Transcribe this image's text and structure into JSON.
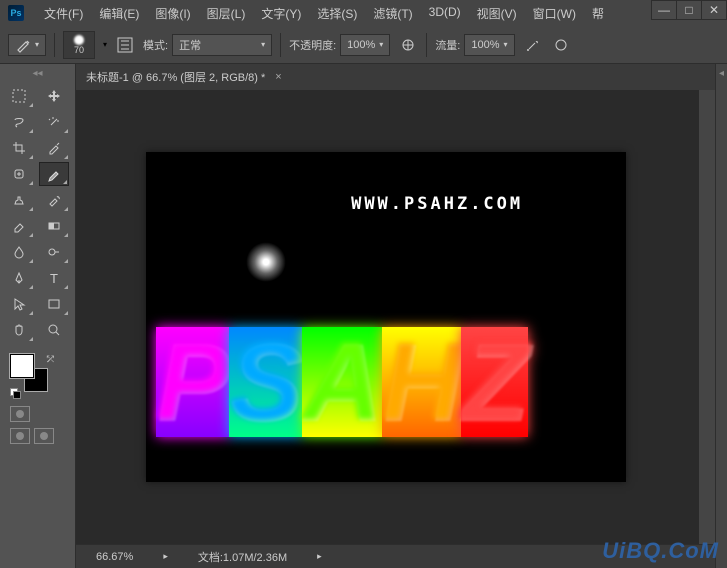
{
  "app": {
    "logo_text": "Ps"
  },
  "menu": {
    "file": "文件(F)",
    "edit": "编辑(E)",
    "image": "图像(I)",
    "layer": "图层(L)",
    "type": "文字(Y)",
    "select": "选择(S)",
    "filter": "滤镜(T)",
    "3d": "3D(D)",
    "view": "视图(V)",
    "window": "窗口(W)",
    "help": "帮"
  },
  "window_controls": {
    "minimize": "—",
    "maximize": "□",
    "close": "✕"
  },
  "options": {
    "brush_size": "70",
    "mode_label": "模式:",
    "mode_value": "正常",
    "opacity_label": "不透明度:",
    "opacity_value": "100%",
    "flow_label": "流量:",
    "flow_value": "100%"
  },
  "document": {
    "tab_title": "未标题-1 @ 66.7% (图层 2, RGB/8) *",
    "tab_close": "×"
  },
  "canvas": {
    "url_text": "WWW.PSAHZ.COM",
    "letters": [
      "P",
      "S",
      "A",
      "H",
      "Z"
    ]
  },
  "status": {
    "zoom": "66.67%",
    "doc_label": "文档:",
    "doc_size": "1.07M/2.36M"
  },
  "swatch": {
    "fg": "#ffffff",
    "bg": "#000000"
  },
  "watermark": "UiBQ.CoM"
}
